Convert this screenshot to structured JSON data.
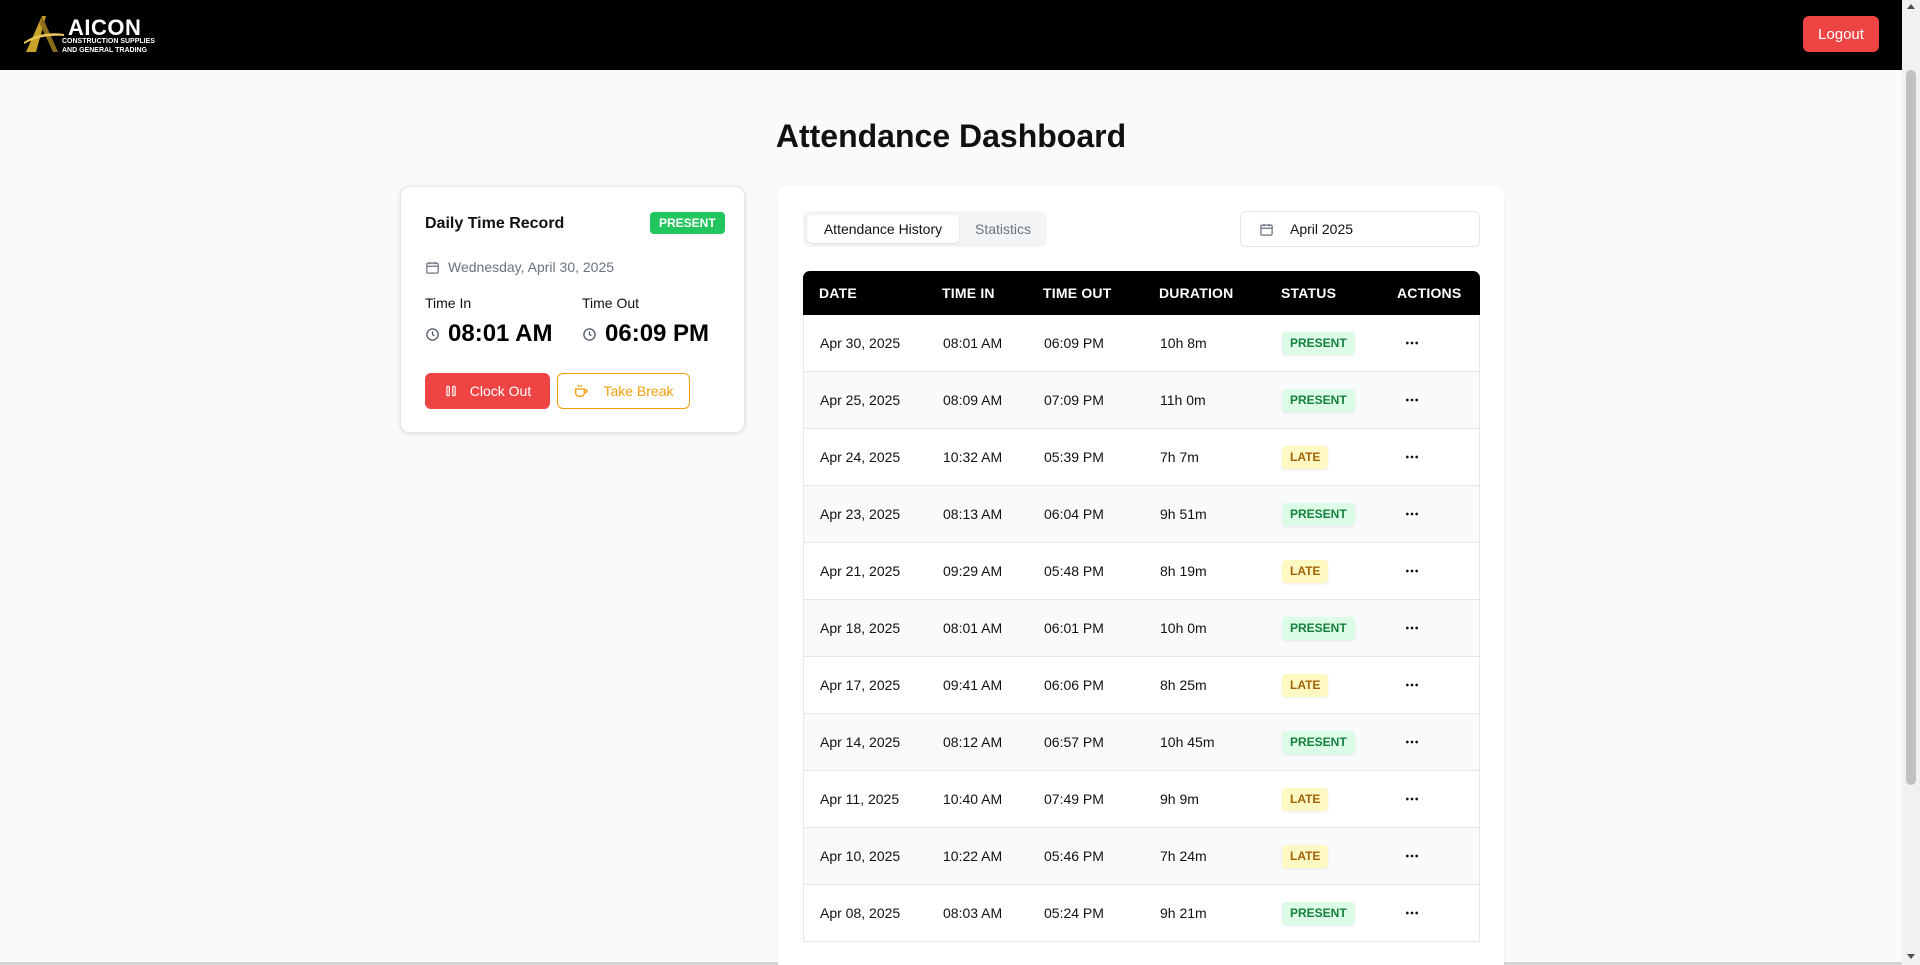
{
  "brand": {
    "name": "AICON",
    "subtitle_line1": "CONSTRUCTION SUPPLIES",
    "subtitle_line2": "AND GENERAL TRADING",
    "gold": "#c9a227"
  },
  "header": {
    "logout_label": "Logout"
  },
  "page": {
    "title": "Attendance Dashboard"
  },
  "daily_record": {
    "title": "Daily Time Record",
    "status": "PRESENT",
    "date": "Wednesday, April 30, 2025",
    "time_in_label": "Time In",
    "time_in_value": "08:01 AM",
    "time_out_label": "Time Out",
    "time_out_value": "06:09 PM",
    "clock_out_label": "Clock Out",
    "take_break_label": "Take Break"
  },
  "tabs": [
    {
      "label": "Attendance History",
      "active": true
    },
    {
      "label": "Statistics",
      "active": false
    }
  ],
  "month_filter": {
    "value": "April 2025"
  },
  "table": {
    "headers": [
      "DATE",
      "TIME IN",
      "TIME OUT",
      "DURATION",
      "STATUS",
      "ACTIONS"
    ],
    "rows": [
      {
        "date": "Apr 30, 2025",
        "time_in": "08:01 AM",
        "time_out": "06:09 PM",
        "duration": "10h 8m",
        "status": "PRESENT"
      },
      {
        "date": "Apr 25, 2025",
        "time_in": "08:09 AM",
        "time_out": "07:09 PM",
        "duration": "11h 0m",
        "status": "PRESENT"
      },
      {
        "date": "Apr 24, 2025",
        "time_in": "10:32 AM",
        "time_out": "05:39 PM",
        "duration": "7h 7m",
        "status": "LATE"
      },
      {
        "date": "Apr 23, 2025",
        "time_in": "08:13 AM",
        "time_out": "06:04 PM",
        "duration": "9h 51m",
        "status": "PRESENT"
      },
      {
        "date": "Apr 21, 2025",
        "time_in": "09:29 AM",
        "time_out": "05:48 PM",
        "duration": "8h 19m",
        "status": "LATE"
      },
      {
        "date": "Apr 18, 2025",
        "time_in": "08:01 AM",
        "time_out": "06:01 PM",
        "duration": "10h 0m",
        "status": "PRESENT"
      },
      {
        "date": "Apr 17, 2025",
        "time_in": "09:41 AM",
        "time_out": "06:06 PM",
        "duration": "8h 25m",
        "status": "LATE"
      },
      {
        "date": "Apr 14, 2025",
        "time_in": "08:12 AM",
        "time_out": "06:57 PM",
        "duration": "10h 45m",
        "status": "PRESENT"
      },
      {
        "date": "Apr 11, 2025",
        "time_in": "10:40 AM",
        "time_out": "07:49 PM",
        "duration": "9h 9m",
        "status": "LATE"
      },
      {
        "date": "Apr 10, 2025",
        "time_in": "10:22 AM",
        "time_out": "05:46 PM",
        "duration": "7h 24m",
        "status": "LATE"
      },
      {
        "date": "Apr 08, 2025",
        "time_in": "08:03 AM",
        "time_out": "05:24 PM",
        "duration": "9h 21m",
        "status": "PRESENT"
      }
    ]
  },
  "icons": {
    "calendar": "calendar-icon",
    "clock": "clock-icon",
    "pause": "pause-icon",
    "coffee": "coffee-icon",
    "more": "more-horizontal-icon"
  },
  "colors": {
    "danger": "#ef4444",
    "success": "#22c55e",
    "warning": "#f59e0b",
    "present_bg": "#dcfce7",
    "present_fg": "#15803d",
    "late_bg": "#fef9c3",
    "late_fg": "#a16207"
  }
}
